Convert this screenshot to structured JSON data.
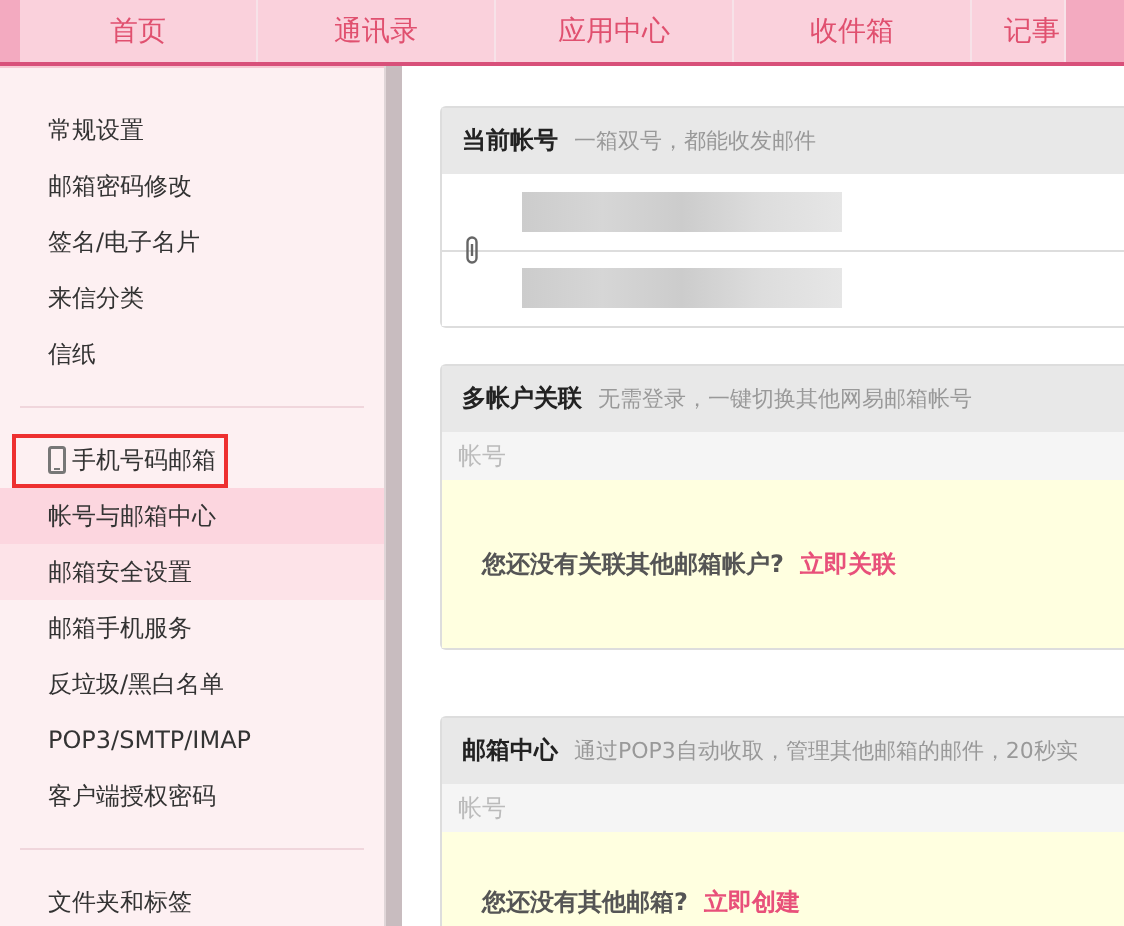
{
  "tabs": [
    {
      "label": "首页",
      "selected": false
    },
    {
      "label": "通讯录",
      "selected": false
    },
    {
      "label": "应用中心",
      "selected": false
    },
    {
      "label": "收件箱",
      "selected": false
    },
    {
      "label": "记事",
      "selected": false
    }
  ],
  "sidebar": {
    "groups": [
      {
        "items": [
          {
            "label": "常规设置",
            "kind": "plain",
            "selected": false,
            "hovered": false,
            "outlined": false
          },
          {
            "label": "邮箱密码修改",
            "kind": "plain",
            "selected": false,
            "hovered": false,
            "outlined": false
          },
          {
            "label": "签名/电子名片",
            "kind": "plain",
            "selected": false,
            "hovered": false,
            "outlined": false
          },
          {
            "label": "来信分类",
            "kind": "plain",
            "selected": false,
            "hovered": false,
            "outlined": false
          },
          {
            "label": "信纸",
            "kind": "plain",
            "selected": false,
            "hovered": false,
            "outlined": false
          }
        ]
      },
      {
        "items": [
          {
            "label": "手机号码邮箱",
            "kind": "phone",
            "selected": false,
            "hovered": false,
            "outlined": true
          },
          {
            "label": "帐号与邮箱中心",
            "kind": "plain",
            "selected": true,
            "hovered": false,
            "outlined": false
          },
          {
            "label": "邮箱安全设置",
            "kind": "plain",
            "selected": false,
            "hovered": true,
            "outlined": false
          },
          {
            "label": "邮箱手机服务",
            "kind": "plain",
            "selected": false,
            "hovered": false,
            "outlined": false
          },
          {
            "label": "反垃圾/黑白名单",
            "kind": "plain",
            "selected": false,
            "hovered": false,
            "outlined": false
          },
          {
            "label": "POP3/SMTP/IMAP",
            "kind": "plain",
            "selected": false,
            "hovered": false,
            "outlined": false
          },
          {
            "label": "客户端授权密码",
            "kind": "plain",
            "selected": false,
            "hovered": false,
            "outlined": false
          }
        ]
      },
      {
        "items": [
          {
            "label": "文件夹和标签",
            "kind": "plain",
            "selected": false,
            "hovered": false,
            "outlined": false
          }
        ]
      }
    ]
  },
  "panels": [
    {
      "kind": "accounts",
      "title": "当前帐号",
      "subtitle": "一箱双号，都能收发邮件"
    },
    {
      "kind": "list",
      "title": "多帐户关联",
      "subtitle": "无需登录，一键切换其他网易邮箱帐号",
      "column": "帐号",
      "empty_text": "您还没有关联其他邮箱帐户?",
      "link": "立即关联"
    },
    {
      "kind": "list",
      "title": "邮箱中心",
      "subtitle": "通过POP3自动收取，管理其他邮箱的邮件，20秒实",
      "column": "帐号",
      "empty_text": "您还没有其他邮箱?",
      "link": "立即创建"
    }
  ]
}
